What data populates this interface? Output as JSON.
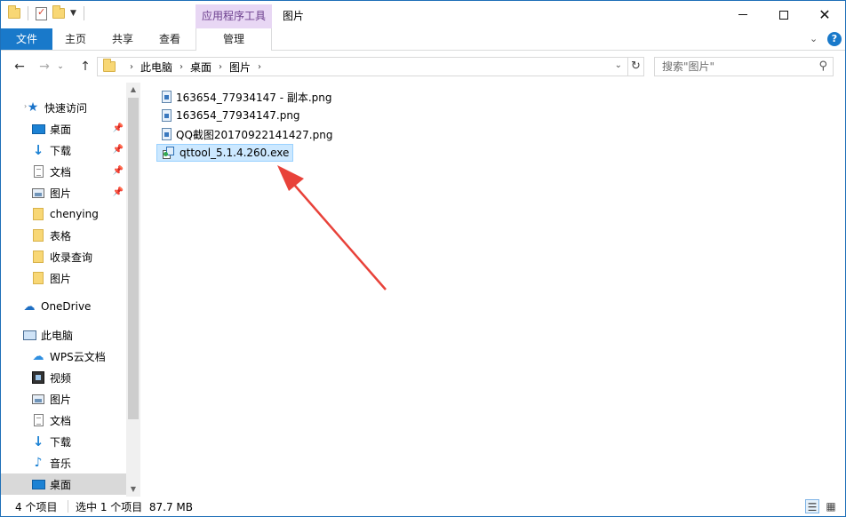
{
  "titlebar": {
    "context_tab_header": "应用程序工具",
    "window_title": "图片"
  },
  "ribbon": {
    "tabs": [
      "文件",
      "主页",
      "共享",
      "查看",
      "管理"
    ]
  },
  "address": {
    "crumbs": [
      "此电脑",
      "桌面",
      "图片"
    ],
    "search_placeholder": "搜索\"图片\""
  },
  "sidebar": {
    "items": [
      {
        "label": "快速访问",
        "icon": "star-icon"
      },
      {
        "label": "桌面",
        "icon": "desktop-icon",
        "pinned": true
      },
      {
        "label": "下载",
        "icon": "download-icon",
        "pinned": true
      },
      {
        "label": "文档",
        "icon": "document-icon",
        "pinned": true
      },
      {
        "label": "图片",
        "icon": "pictures-icon",
        "pinned": true
      },
      {
        "label": "chenying",
        "icon": "folder-icon"
      },
      {
        "label": "表格",
        "icon": "folder-icon"
      },
      {
        "label": "收录查询",
        "icon": "folder-icon"
      },
      {
        "label": "图片",
        "icon": "folder-icon"
      },
      {
        "label": "OneDrive",
        "icon": "cloud-icon"
      },
      {
        "label": "此电脑",
        "icon": "computer-icon"
      },
      {
        "label": "WPS云文档",
        "icon": "wps-cloud-icon"
      },
      {
        "label": "视频",
        "icon": "video-icon"
      },
      {
        "label": "图片",
        "icon": "pictures-icon"
      },
      {
        "label": "文档",
        "icon": "document-icon"
      },
      {
        "label": "下载",
        "icon": "download-icon"
      },
      {
        "label": "音乐",
        "icon": "music-icon"
      },
      {
        "label": "桌面",
        "icon": "desktop-icon",
        "selected": true
      }
    ]
  },
  "files": [
    {
      "name": "163654_77934147 - 副本.png",
      "icon": "png-file-icon"
    },
    {
      "name": "163654_77934147.png",
      "icon": "png-file-icon"
    },
    {
      "name": "QQ截图20170922141427.png",
      "icon": "png-file-icon"
    },
    {
      "name": "qttool_5.1.4.260.exe",
      "icon": "exe-file-icon",
      "selected": true
    }
  ],
  "statusbar": {
    "count": "4 个项目",
    "selected": "选中 1 个项目  87.7 MB"
  },
  "colors": {
    "accent": "#1979ca",
    "context_tab": "#e8d7f4",
    "selection": "#cce8ff",
    "annotation_arrow": "#e8423a"
  }
}
